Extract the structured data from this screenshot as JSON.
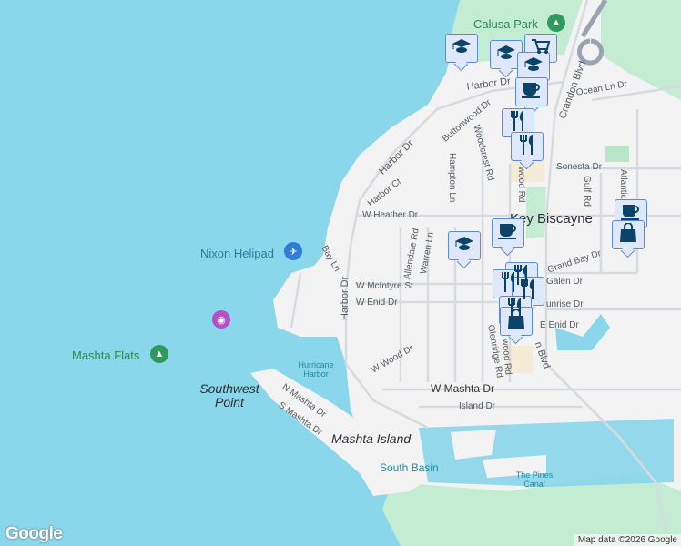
{
  "labels": {
    "calusa_park": "Calusa Park",
    "harbor_dr_n": "Harbor Dr",
    "harbor_dr_w": "Harbor Dr",
    "harbor_dr_s": "Harbor Dr",
    "ocean_ln_dr": "Ocean Ln Dr",
    "crandon_blvd_n": "Crandon Blvd",
    "crandon_blvd_s": "n Blvd",
    "buttonwood_dr": "Buttonwood Dr",
    "woodcrest_rd": "Woodcrest Rd",
    "hampton_ln": "Hampton Ln",
    "harbor_ct": "Harbor Ct",
    "w_heather_dr": "W Heather Dr",
    "sonesta_dr": "Sonesta Dr",
    "gulf_rd": "Gulf Rd",
    "atlantic": "Atlantic",
    "key_biscayne": "Key Biscayne",
    "allendale_rd": "Allendale Rd",
    "warren_ln": "Warren Ln",
    "grand_bay_dr": "Grand Bay Dr",
    "bay_ln": "Bay Ln",
    "nixon_helipad": "Nixon Helipad",
    "w_mcintyre_st": "W McIntyre St",
    "w_enid_dr": "W Enid Dr",
    "galen_dr": "Galen Dr",
    "sunrise_dr": "unrise Dr",
    "e_enid_dr": "E Enid Dr",
    "glenridge_rd": "Glenridge Rd",
    "wood_rd_n": "wood Rd",
    "wood_rd_s": "wood Rd",
    "w_wood_dr": "W Wood Dr",
    "hurricane_harbor": "Hurricane Harbor",
    "mashta_flats": "Mashta Flats",
    "southwest_point": "Southwest Point",
    "n_mashta_dr": "N Mashta Dr",
    "s_mashta_dr": "S Mashta Dr",
    "w_mashta_dr": "W Mashta Dr",
    "island_dr": "Island Dr",
    "mashta_island": "Mashta Island",
    "south_basin": "South Basin",
    "the_pines_canal": "The Pines Canal"
  },
  "markers": [
    {
      "type": "school"
    },
    {
      "type": "school"
    },
    {
      "type": "shopping-cart"
    },
    {
      "type": "school"
    },
    {
      "type": "cafe"
    },
    {
      "type": "restaurant"
    },
    {
      "type": "restaurant"
    },
    {
      "type": "cafe"
    },
    {
      "type": "shopping-bag"
    },
    {
      "type": "school"
    },
    {
      "type": "cafe"
    },
    {
      "type": "restaurant"
    },
    {
      "type": "restaurant"
    },
    {
      "type": "restaurant"
    },
    {
      "type": "restaurant"
    },
    {
      "type": "shopping-bag"
    }
  ],
  "footer": {
    "attribution": "Map data ©2026 Google",
    "logo": "Google"
  },
  "colors": {
    "water": "#8ad6ea",
    "land": "#f3f3f4",
    "park": "#c4ecd2",
    "marker_bg": "#dfe8fb",
    "marker_border": "#5c8bd8",
    "marker_icon": "#0b4468"
  }
}
